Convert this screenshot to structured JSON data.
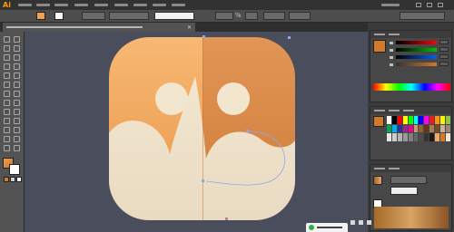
{
  "app": {
    "logo": "Ai"
  },
  "optionsbar": {
    "percent_sign": "%"
  },
  "colors": {
    "accent_orange": "#f0a050",
    "artwork_top_left": "#f5b56d",
    "artwork_top_right": "#d88a4a",
    "artwork_cream": "#f3e8d3",
    "canvas_bg": "#4a4d5c"
  },
  "icons": {
    "doc_tab_close": "close-icon",
    "tools": [
      "selection-tool-icon",
      "direct-selection-tool-icon",
      "magic-wand-tool-icon",
      "lasso-tool-icon",
      "pen-tool-icon",
      "type-tool-icon",
      "line-tool-icon",
      "rectangle-tool-icon",
      "paintbrush-tool-icon",
      "pencil-tool-icon",
      "eraser-tool-icon",
      "rotate-tool-icon",
      "scale-tool-icon",
      "width-tool-icon",
      "free-transform-tool-icon",
      "shape-builder-tool-icon",
      "perspective-tool-icon",
      "mesh-tool-icon",
      "gradient-tool-icon",
      "eyedropper-tool-icon",
      "blend-tool-icon",
      "symbol-sprayer-tool-icon",
      "column-graph-tool-icon",
      "artboard-tool-icon",
      "slice-tool-icon",
      "hand-tool-icon",
      "zoom-tool-icon"
    ]
  }
}
